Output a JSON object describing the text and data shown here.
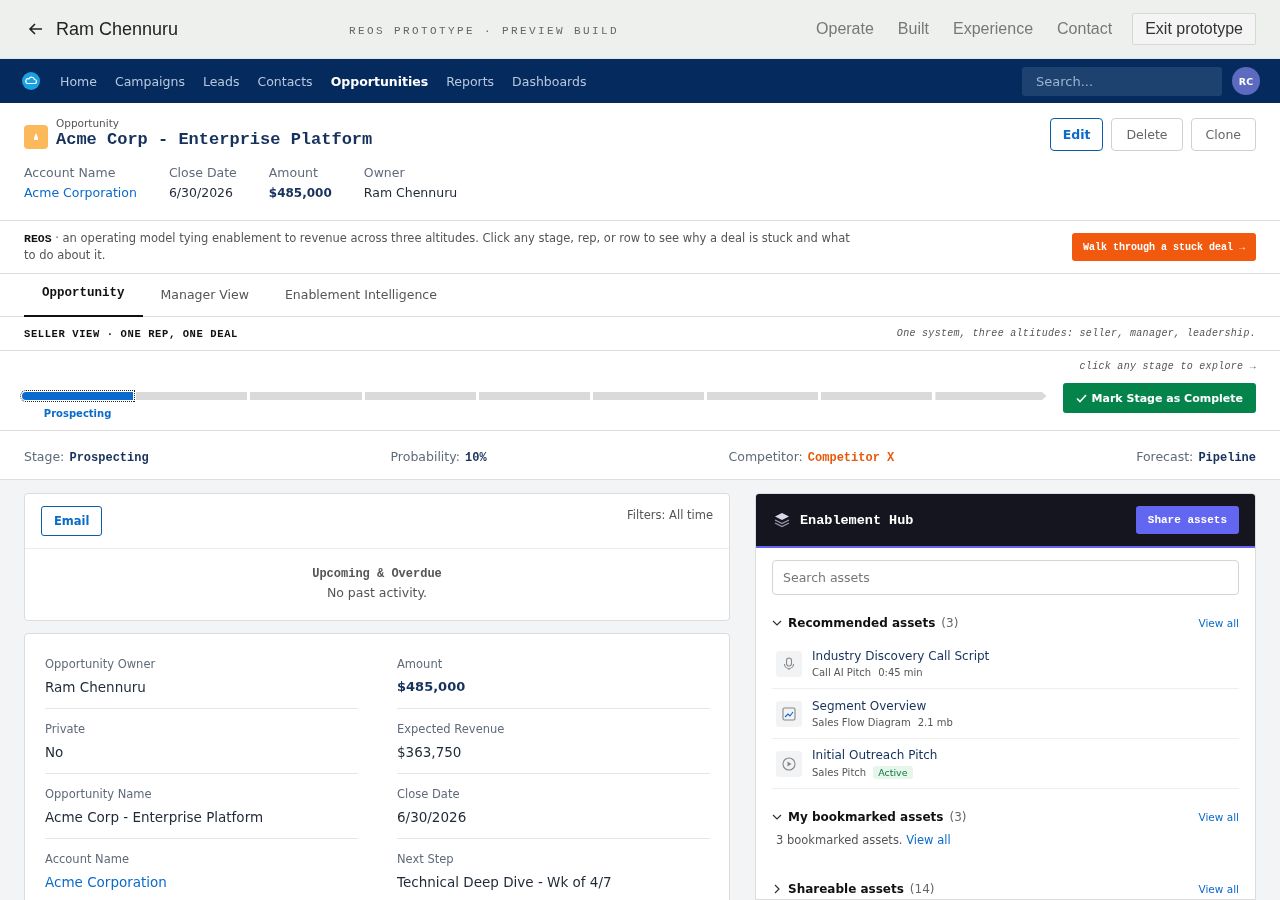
{
  "top_bar": {
    "title": "Ram Chennuru",
    "subtitle": "REOS PROTOTYPE · PREVIEW BUILD",
    "links": [
      "Operate",
      "Built",
      "Experience",
      "Contact"
    ],
    "exit_button": "Exit prototype"
  },
  "nav": {
    "items": [
      {
        "label": "Home",
        "selected": false
      },
      {
        "label": "Campaigns",
        "selected": false
      },
      {
        "label": "Leads",
        "selected": false
      },
      {
        "label": "Contacts",
        "selected": false
      },
      {
        "label": "Opportunities",
        "selected": true
      },
      {
        "label": "Reports",
        "selected": false
      },
      {
        "label": "Dashboards",
        "selected": false
      }
    ],
    "search": {
      "placeholder": "Search..."
    },
    "avatar": "RC"
  },
  "record": {
    "type": "Opportunity",
    "title": "Acme Corp - Enterprise Platform",
    "buttons": [
      {
        "label": "Edit",
        "kind": "primary"
      },
      {
        "label": "Delete",
        "kind": "neutral"
      },
      {
        "label": "Clone",
        "kind": "neutral"
      }
    ],
    "fields": [
      {
        "label": "Account Name",
        "value": "Acme Corporation",
        "kind": "link"
      },
      {
        "label": "Close Date",
        "value": "6/30/2026",
        "kind": "text"
      },
      {
        "label": "Amount",
        "value": "$485,000",
        "kind": "strong"
      },
      {
        "label": "Owner",
        "value": "Ram Chennuru",
        "kind": "text"
      }
    ]
  },
  "banner": {
    "text": "**REOS** · an operating model tying enablement to revenue across three altitudes. Click any stage, rep, or row to see why a deal is stuck and what to do about it.",
    "button": "Walk through a stuck deal →"
  },
  "tabs": [
    {
      "label": "Opportunity",
      "selected": true
    },
    {
      "label": "Manager View",
      "selected": false
    },
    {
      "label": "Enablement Intelligence",
      "selected": false
    }
  ],
  "view": {
    "title": "SELLER VIEW · ONE REP, ONE DEAL",
    "tagline": "One system, three altitudes: seller, manager, leadership."
  },
  "path": {
    "hint": "click any stage to explore →",
    "stages": [
      {
        "label": "Prospecting",
        "selected": true
      },
      {
        "selected": false
      },
      {
        "selected": false
      },
      {
        "selected": false
      },
      {
        "selected": false
      },
      {
        "selected": false
      },
      {
        "selected": false
      },
      {
        "selected": false
      },
      {
        "selected": false
      }
    ],
    "button": "Mark Stage as Complete"
  },
  "summary": [
    {
      "label": "Stage:",
      "value": "Prospecting",
      "kind": "plain"
    },
    {
      "label": "Probability:",
      "value": "10%",
      "kind": "plain"
    },
    {
      "label": "Competitor:",
      "value": "Competitor X",
      "kind": "alert"
    },
    {
      "label": "Forecast:",
      "value": "Pipeline",
      "kind": "plain"
    }
  ],
  "activity": {
    "button": "Email",
    "filters": "Filters: All time",
    "heading": "Upcoming & Overdue",
    "empty": "No past activity."
  },
  "details": {
    "fields": [
      {
        "label": "Opportunity Owner",
        "value": "Ram Chennuru",
        "kind": "text"
      },
      {
        "label": "Amount",
        "value": "$485,000",
        "kind": "strong"
      },
      {
        "label": "Private",
        "value": "No",
        "kind": "text"
      },
      {
        "label": "Expected Revenue",
        "value": "$363,750",
        "kind": "text"
      },
      {
        "label": "Opportunity Name",
        "value": "Acme Corp - Enterprise Platform",
        "kind": "text"
      },
      {
        "label": "Close Date",
        "value": "6/30/2026",
        "kind": "text"
      },
      {
        "label": "Account Name",
        "value": "Acme Corporation",
        "kind": "link"
      },
      {
        "label": "Next Step",
        "value": "Technical Deep Dive - Wk of 4/7",
        "kind": "text"
      }
    ]
  },
  "hub": {
    "title": "Enablement Hub",
    "button": "Share assets",
    "search": {
      "placeholder": "Search assets"
    },
    "sections": [
      {
        "title": "Recommended assets",
        "count": "(3)",
        "expanded": true,
        "link": "View all",
        "assets": [
          {
            "title": "Industry Discovery Call Script",
            "type": "Call AI Pitch",
            "meta": "0:45 min",
            "kind": "audio"
          },
          {
            "title": "Segment Overview",
            "type": "Sales Flow Diagram",
            "meta": "2.1 mb",
            "kind": "chart"
          },
          {
            "title": "Initial Outreach Pitch",
            "type": "Sales Pitch",
            "badge": "Active",
            "kind": "video"
          }
        ]
      },
      {
        "title": "My bookmarked assets",
        "count": "(3)",
        "expanded": true,
        "link": "View all",
        "note": "3 bookmarked assets.",
        "note_link": "View all"
      },
      {
        "title": "Shareable assets",
        "count": "(14)",
        "expanded": false,
        "link": "View all"
      }
    ]
  }
}
